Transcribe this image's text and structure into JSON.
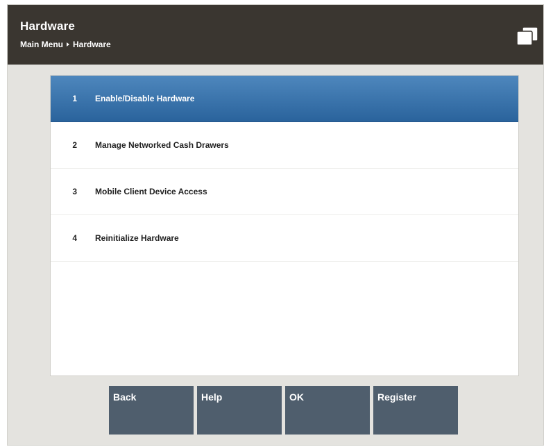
{
  "header": {
    "title": "Hardware",
    "breadcrumb": [
      "Main Menu",
      "Hardware"
    ],
    "icon": "folders-icon"
  },
  "menu": {
    "items": [
      {
        "number": "1",
        "label": "Enable/Disable Hardware",
        "selected": true
      },
      {
        "number": "2",
        "label": "Manage Networked Cash Drawers",
        "selected": false
      },
      {
        "number": "3",
        "label": "Mobile Client Device Access",
        "selected": false
      },
      {
        "number": "4",
        "label": "Reinitialize Hardware",
        "selected": false
      }
    ]
  },
  "toolbar": {
    "back_label": "Back",
    "help_label": "Help",
    "ok_label": "OK",
    "register_label": "Register"
  },
  "colors": {
    "header_bg": "#3a3630",
    "selected_bg": "#2a639c",
    "button_bg": "#4f5e6d",
    "frame_bg": "#e4e3df"
  }
}
